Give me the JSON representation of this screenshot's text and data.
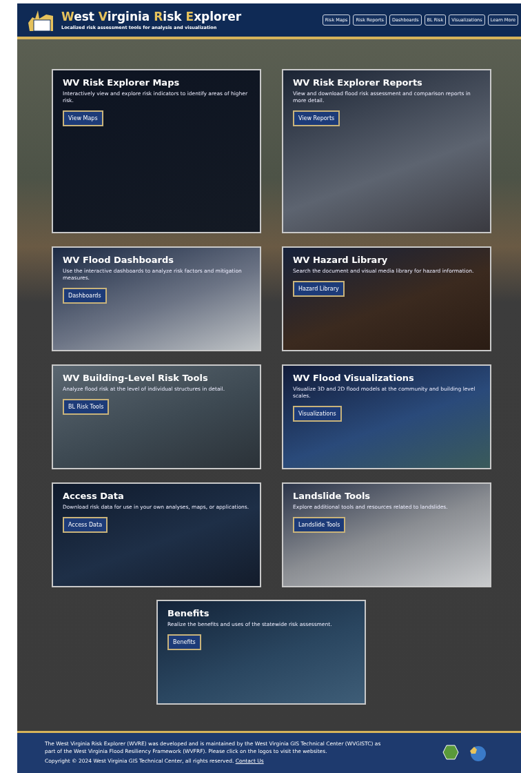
{
  "header": {
    "title_parts": [
      {
        "text": "W",
        "accent": true
      },
      {
        "text": "est ",
        "accent": false
      },
      {
        "text": "V",
        "accent": true
      },
      {
        "text": "irginia ",
        "accent": false
      },
      {
        "text": "R",
        "accent": true
      },
      {
        "text": "isk ",
        "accent": false
      },
      {
        "text": "E",
        "accent": true
      },
      {
        "text": "xplorer",
        "accent": false
      }
    ],
    "subtitle": "Localized risk assessment tools for analysis and visualization",
    "nav": [
      "Risk Maps",
      "Risk Reports",
      "Dashboards",
      "BL Risk",
      "Visualizations",
      "Learn More"
    ]
  },
  "cards": [
    {
      "kind": "map",
      "title": "WV Risk Explorer Maps",
      "description": "Interactively view and explore risk indicators to identify areas of higher risk.",
      "button": "View Maps"
    },
    {
      "kind": "reports",
      "title": "WV Risk Explorer Reports",
      "description": "View and download flood risk assessment and comparison reports in more detail.",
      "button": "View Reports"
    },
    {
      "kind": "dashboards",
      "title": "WV Flood Dashboards",
      "description": "Use the interactive dashboards to analyze risk factors and mitigation measures.",
      "button": "Dashboards"
    },
    {
      "kind": "library",
      "title": "WV Hazard Library",
      "description": "Search the document and visual media library for hazard information.",
      "button": "Hazard Library"
    },
    {
      "kind": "street",
      "title": "WV Building-Level Risk Tools",
      "description": "Analyze flood risk at the level of individual structures in detail.",
      "button": "BL Risk Tools"
    },
    {
      "kind": "flood",
      "title": "WV Flood Visualizations",
      "description": "Visualize 3D and 2D flood models at the community and building level scales.",
      "button": "Visualizations"
    },
    {
      "kind": "servers",
      "title": "Access Data",
      "description": "Download risk data for use in your own analyses, maps, or applications.",
      "button": "Access Data"
    },
    {
      "kind": "terrain",
      "title": "Landslide Tools",
      "description": "Explore additional tools and resources related to landslides.",
      "button": "Landslide Tools"
    },
    {
      "kind": "benefits",
      "title": "Benefits",
      "description": "Realize the benefits and uses of the statewide risk assessment.",
      "button": "Benefits"
    }
  ],
  "footer": {
    "about": "The West Virginia Risk Explorer (WVRE) was developed and is maintained by the West Virginia GIS Technical Center (WVGISTC) as part of the West Virginia Flood Resiliency Framework (WVFRF). Please click on the logos to visit the websites.",
    "copyright": "Copyright © 2024 West Virginia GIS Technical Center, all rights reserved.",
    "contact": "Contact Us"
  }
}
